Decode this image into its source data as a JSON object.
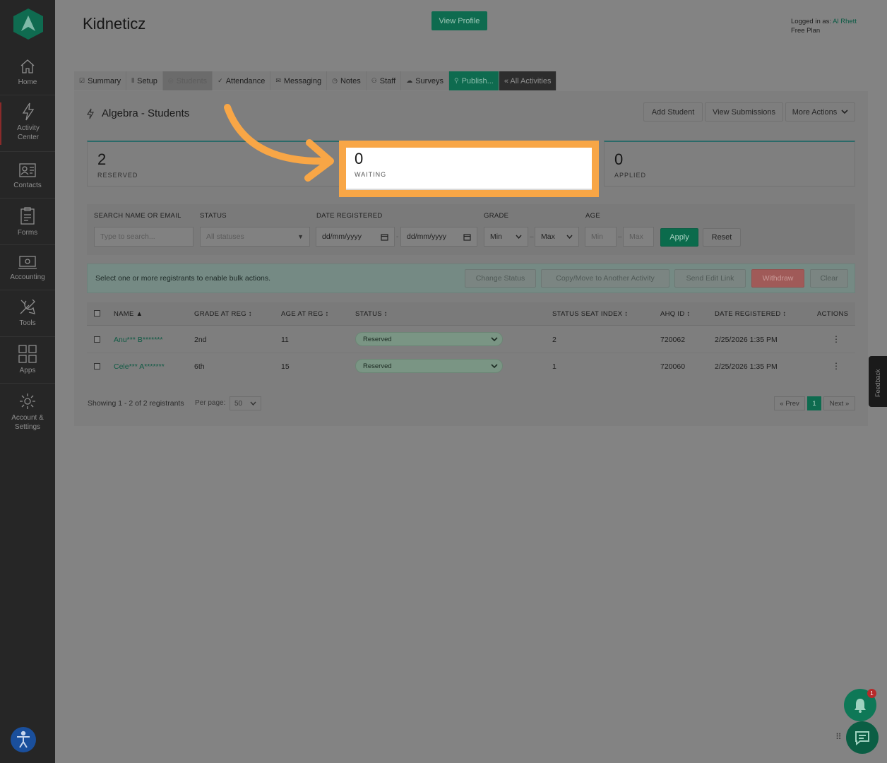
{
  "sidebar": {
    "items": [
      {
        "label": "Home",
        "icon": "home-icon"
      },
      {
        "label": "Activity Center",
        "icon": "lightning-icon"
      },
      {
        "label": "Contacts",
        "icon": "contacts-icon"
      },
      {
        "label": "Forms",
        "icon": "forms-icon"
      },
      {
        "label": "Accounting",
        "icon": "accounting-icon"
      },
      {
        "label": "Tools",
        "icon": "tools-icon"
      },
      {
        "label": "Apps",
        "icon": "apps-icon"
      },
      {
        "label": "Account & Settings",
        "icon": "gear-icon"
      }
    ]
  },
  "header": {
    "title": "Kidneticz",
    "view_profile": "View Profile",
    "logged_in_label": "Logged in as:",
    "user": "Al Rhett",
    "plan": "Free Plan"
  },
  "tabs": [
    {
      "label": "Summary",
      "icon": "summary-icon"
    },
    {
      "label": "Setup",
      "icon": "setup-icon"
    },
    {
      "label": "Students",
      "icon": "students-icon"
    },
    {
      "label": "Attendance",
      "icon": "check-icon"
    },
    {
      "label": "Messaging",
      "icon": "mail-icon"
    },
    {
      "label": "Notes",
      "icon": "notes-icon"
    },
    {
      "label": "Staff",
      "icon": "staff-icon"
    },
    {
      "label": "Surveys",
      "icon": "cloud-icon"
    },
    {
      "label": "Publish...",
      "icon": "link-icon"
    },
    {
      "label": "« All Activities",
      "icon": ""
    }
  ],
  "section": {
    "title": "Algebra - Students",
    "add_student": "Add Student",
    "view_submissions": "View Submissions",
    "more_actions": "More Actions"
  },
  "stats": [
    {
      "value": "2",
      "label": "RESERVED"
    },
    {
      "value": "0",
      "label": "WAITING"
    },
    {
      "value": "0",
      "label": "APPLIED"
    }
  ],
  "filters": {
    "search_label": "SEARCH NAME OR EMAIL",
    "search_placeholder": "Type to search...",
    "status_label": "STATUS",
    "status_value": "All statuses",
    "date_label": "DATE REGISTERED",
    "date_from": "dd/mm/yyyy",
    "date_to": "dd/mm/yyyy",
    "date_sep": "-",
    "grade_label": "GRADE",
    "grade_min": "Min",
    "grade_max": "Max",
    "age_label": "AGE",
    "age_min": "Min",
    "age_max": "Max",
    "range_sep": "–",
    "apply": "Apply",
    "reset": "Reset"
  },
  "bulk": {
    "message": "Select one or more registrants to enable bulk actions.",
    "change_status": "Change Status",
    "copy_move": "Copy/Move to Another Activity",
    "send_edit_link": "Send Edit Link",
    "withdraw": "Withdraw",
    "clear": "Clear"
  },
  "table": {
    "columns": [
      "NAME ▲",
      "GRADE AT REG ↕",
      "AGE AT REG ↕",
      "STATUS ↕",
      "STATUS SEAT INDEX ↕",
      "AHQ ID ↕",
      "DATE REGISTERED ↕",
      "ACTIONS"
    ],
    "rows": [
      {
        "name": "Anu*** B*******",
        "grade": "2nd",
        "age": "11",
        "status": "Reserved",
        "seat_index": "2",
        "ahq_id": "720062",
        "date": "2/25/2026 1:35 PM",
        "actions": "⋮"
      },
      {
        "name": "Cele*** A*******",
        "grade": "6th",
        "age": "15",
        "status": "Reserved",
        "seat_index": "1",
        "ahq_id": "720060",
        "date": "2/25/2026 1:35 PM",
        "actions": "⋮"
      }
    ]
  },
  "footer": {
    "showing": "Showing 1 - 2 of 2 registrants",
    "per_page_label": "Per page:",
    "per_page": "50",
    "prev": "« Prev",
    "page": "1",
    "next": "Next »"
  },
  "widgets": {
    "feedback": "Feedback",
    "notification_count": "1"
  },
  "colors": {
    "accent": "#0e6b4f",
    "highlight": "#f8a646",
    "sidebar_bg": "#262626"
  }
}
